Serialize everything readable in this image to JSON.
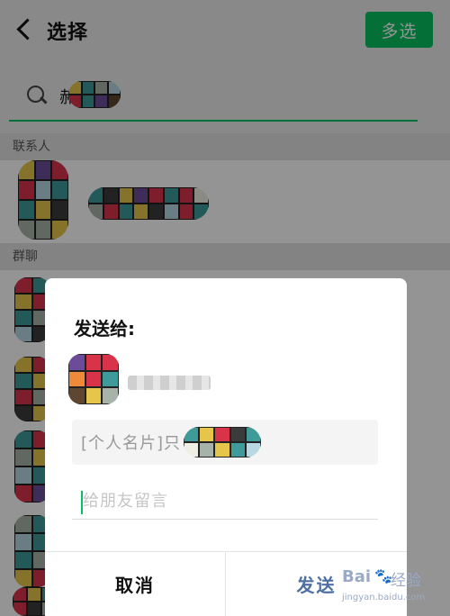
{
  "header": {
    "title": "选择",
    "multi_select_label": "多选"
  },
  "search": {
    "placeholder": "",
    "query_visible_char": "郝"
  },
  "sections": {
    "contacts": "联系人",
    "groups": "群聊"
  },
  "dialog": {
    "title": "发送给:",
    "card_preview": "[个人名片]只",
    "message_placeholder": "给朋友留言",
    "cancel_label": "取消",
    "send_label": "发送"
  },
  "watermark": {
    "brand": "Bai",
    "brand_suffix": "经验",
    "url": "jingyan.baidu.com"
  },
  "colors": {
    "accent_green": "#07c160",
    "send_blue": "#4f6fa3"
  },
  "icons": [
    "back-arrow-icon",
    "search-icon"
  ]
}
